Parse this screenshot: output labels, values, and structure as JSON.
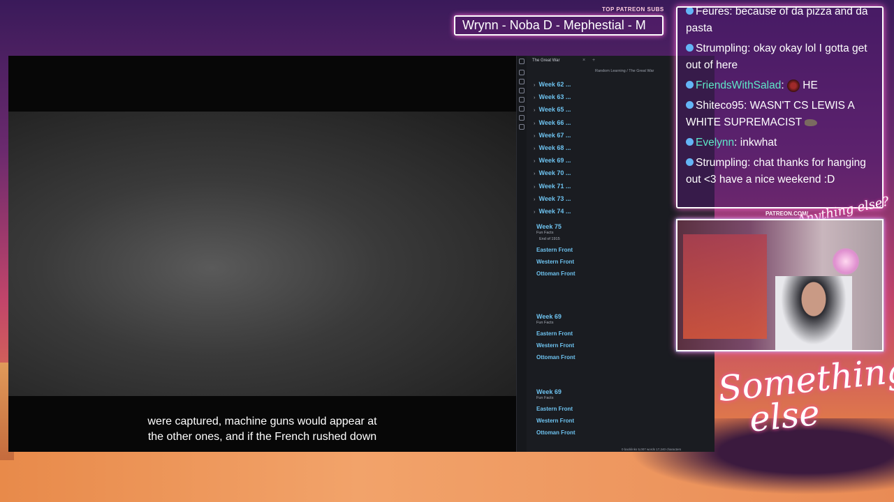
{
  "patreon": {
    "header": "TOP PATREON SUBS",
    "names": "Wrynn -  Noba D - Mephestial - M"
  },
  "video": {
    "subtitle_line1": "were captured, machine guns would appear at",
    "subtitle_line2": "the other ones, and if the French rushed down"
  },
  "notes": {
    "tab_title": "The Great War",
    "tab_close": "×",
    "tab_add": "+",
    "breadcrumb": "Random Learning  /  The Great War",
    "weeks": [
      "Week 62 ...",
      "Week 63 ...",
      "Week 65 ...",
      "Week 66 ...",
      "Week 67 ...",
      "Week 68 ...",
      "Week 69 ...",
      "Week 70 ...",
      "Week 71 ...",
      "Week 73 ...",
      "Week 74 ..."
    ],
    "block1": {
      "title": "Week 75",
      "sub": "Fun Facts",
      "subsub": "End of 1915",
      "fronts": [
        "Eastern Front",
        "Western Front",
        "Ottoman Front"
      ]
    },
    "block2": {
      "title": "Week 69",
      "sub": "Fun Facts",
      "fronts": [
        "Eastern Front",
        "Western Front",
        "Ottoman Front"
      ]
    },
    "block3": {
      "title": "Week 69",
      "sub": "Fun Facts",
      "fronts": [
        "Eastern Front",
        "Western Front",
        "Ottoman Front"
      ]
    },
    "status": "0 backlinks    5,007 words   17,240 characters"
  },
  "chat": {
    "messages": [
      {
        "user": "Feures",
        "text": ": because of da pizza and da pasta"
      },
      {
        "user": "Strumpling",
        "text": ": okay okay lol I gotta get out of here"
      },
      {
        "user": "FriendsWithSalad",
        "text": ": ",
        "after_emote": " HE"
      },
      {
        "user": "Shiteco95",
        "text": ": WASN'T CS LEWIS A WHITE SUPREMACIST"
      },
      {
        "user": "Evelynn",
        "text": ": inkwhat"
      },
      {
        "user": "Strumpling",
        "text": ": chat thanks for hanging out <3 have a nice weekend :D"
      }
    ],
    "colors": {
      "default_user": "#ffffff",
      "green_user": "#5ee8c8",
      "badge": "#64b5f6"
    }
  },
  "overlay": {
    "patreon_url": "PATREON.COM/",
    "logo_small": "Anything else?",
    "logo_big_line1": "Something",
    "logo_big_line2": "else"
  }
}
